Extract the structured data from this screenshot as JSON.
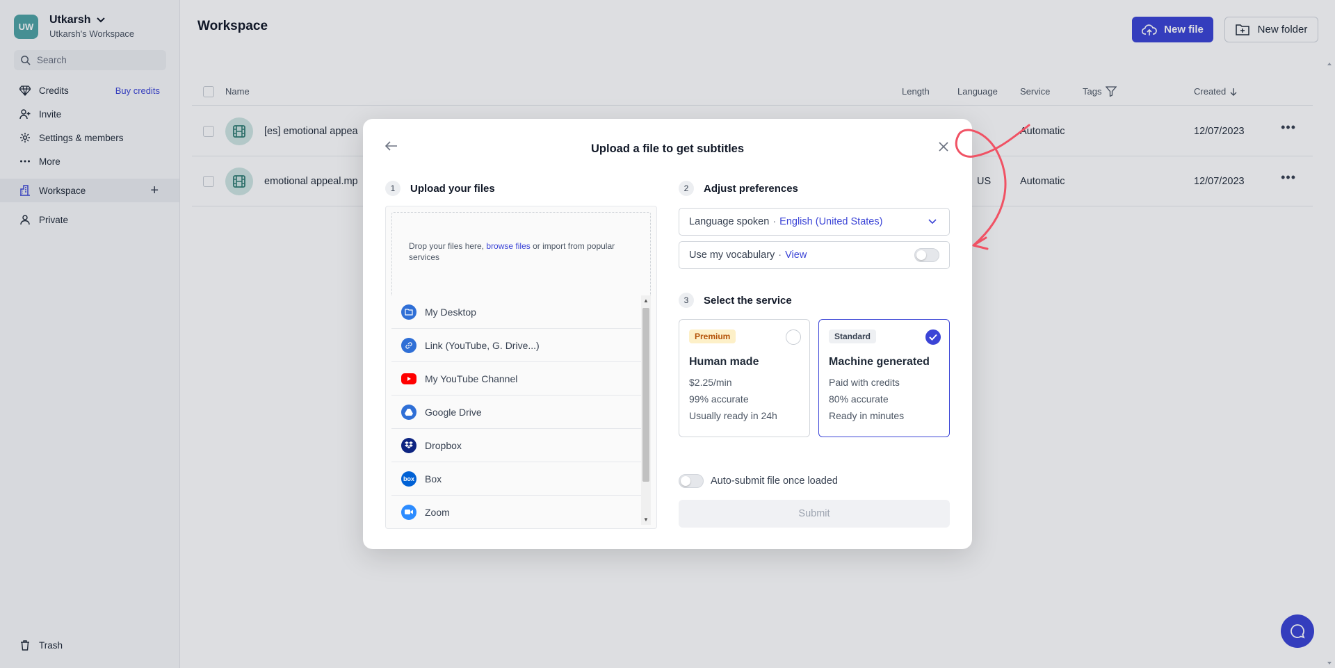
{
  "account": {
    "initials": "UW",
    "name": "Utkarsh",
    "workspace": "Utkarsh's Workspace"
  },
  "sidebar": {
    "search_placeholder": "Search",
    "items": [
      {
        "label": "Credits",
        "icon": "diamond-icon",
        "extra": "Buy credits"
      },
      {
        "label": "Invite",
        "icon": "user-plus-icon"
      },
      {
        "label": "Settings & members",
        "icon": "gear-icon"
      },
      {
        "label": "More",
        "icon": "dots-icon"
      },
      {
        "label": "Workspace",
        "icon": "building-icon"
      },
      {
        "label": "Private",
        "icon": "user-icon"
      }
    ],
    "trash": "Trash"
  },
  "header": {
    "title": "Workspace",
    "new_file": "New file",
    "new_folder": "New folder"
  },
  "table": {
    "columns": [
      "Name",
      "Length",
      "Language",
      "Service",
      "Tags",
      "Created"
    ],
    "rows": [
      {
        "name": "[es] emotional appea",
        "language": "",
        "service": "Automatic",
        "created": "12/07/2023"
      },
      {
        "name": "emotional appeal.mp",
        "language": "US",
        "service": "Automatic",
        "created": "12/07/2023"
      }
    ]
  },
  "modal": {
    "title": "Upload a file to get subtitles",
    "step1": {
      "num": "1",
      "label": "Upload your files"
    },
    "dropzone": {
      "prefix": "Drop your files here,",
      "link": "browse files",
      "suffix": "or import from popular services"
    },
    "sources": [
      {
        "label": "My Desktop",
        "icon": "folder-icon",
        "color": "#2f6fd6"
      },
      {
        "label": "Link (YouTube, G. Drive...)",
        "icon": "link-icon",
        "color": "#2f6fd6"
      },
      {
        "label": "My YouTube Channel",
        "icon": "youtube-icon",
        "color": "#ff0000"
      },
      {
        "label": "Google Drive",
        "icon": "google-drive-icon",
        "color": "#2f6fd6"
      },
      {
        "label": "Dropbox",
        "icon": "dropbox-icon",
        "color": "#0d2481"
      },
      {
        "label": "Box",
        "icon": "box-icon",
        "color": "#0061d5"
      },
      {
        "label": "Zoom",
        "icon": "zoom-icon",
        "color": "#2d8cff"
      }
    ],
    "step2": {
      "num": "2",
      "label": "Adjust preferences"
    },
    "language": {
      "label": "Language spoken",
      "value": "English (United States)"
    },
    "vocabulary": {
      "label": "Use my vocabulary",
      "link": "View"
    },
    "step3": {
      "num": "3",
      "label": "Select the service"
    },
    "services": [
      {
        "badge": "Premium",
        "name": "Human made",
        "price": "$2.25/min",
        "accuracy": "99% accurate",
        "time": "Usually ready in 24h",
        "selected": false
      },
      {
        "badge": "Standard",
        "name": "Machine generated",
        "price": "Paid with credits",
        "accuracy": "80% accurate",
        "time": "Ready in minutes",
        "selected": true
      }
    ],
    "auto_submit": "Auto-submit file once loaded",
    "submit": "Submit"
  },
  "colors": {
    "accent": "#3b44d6",
    "annotation": "#f05264"
  }
}
